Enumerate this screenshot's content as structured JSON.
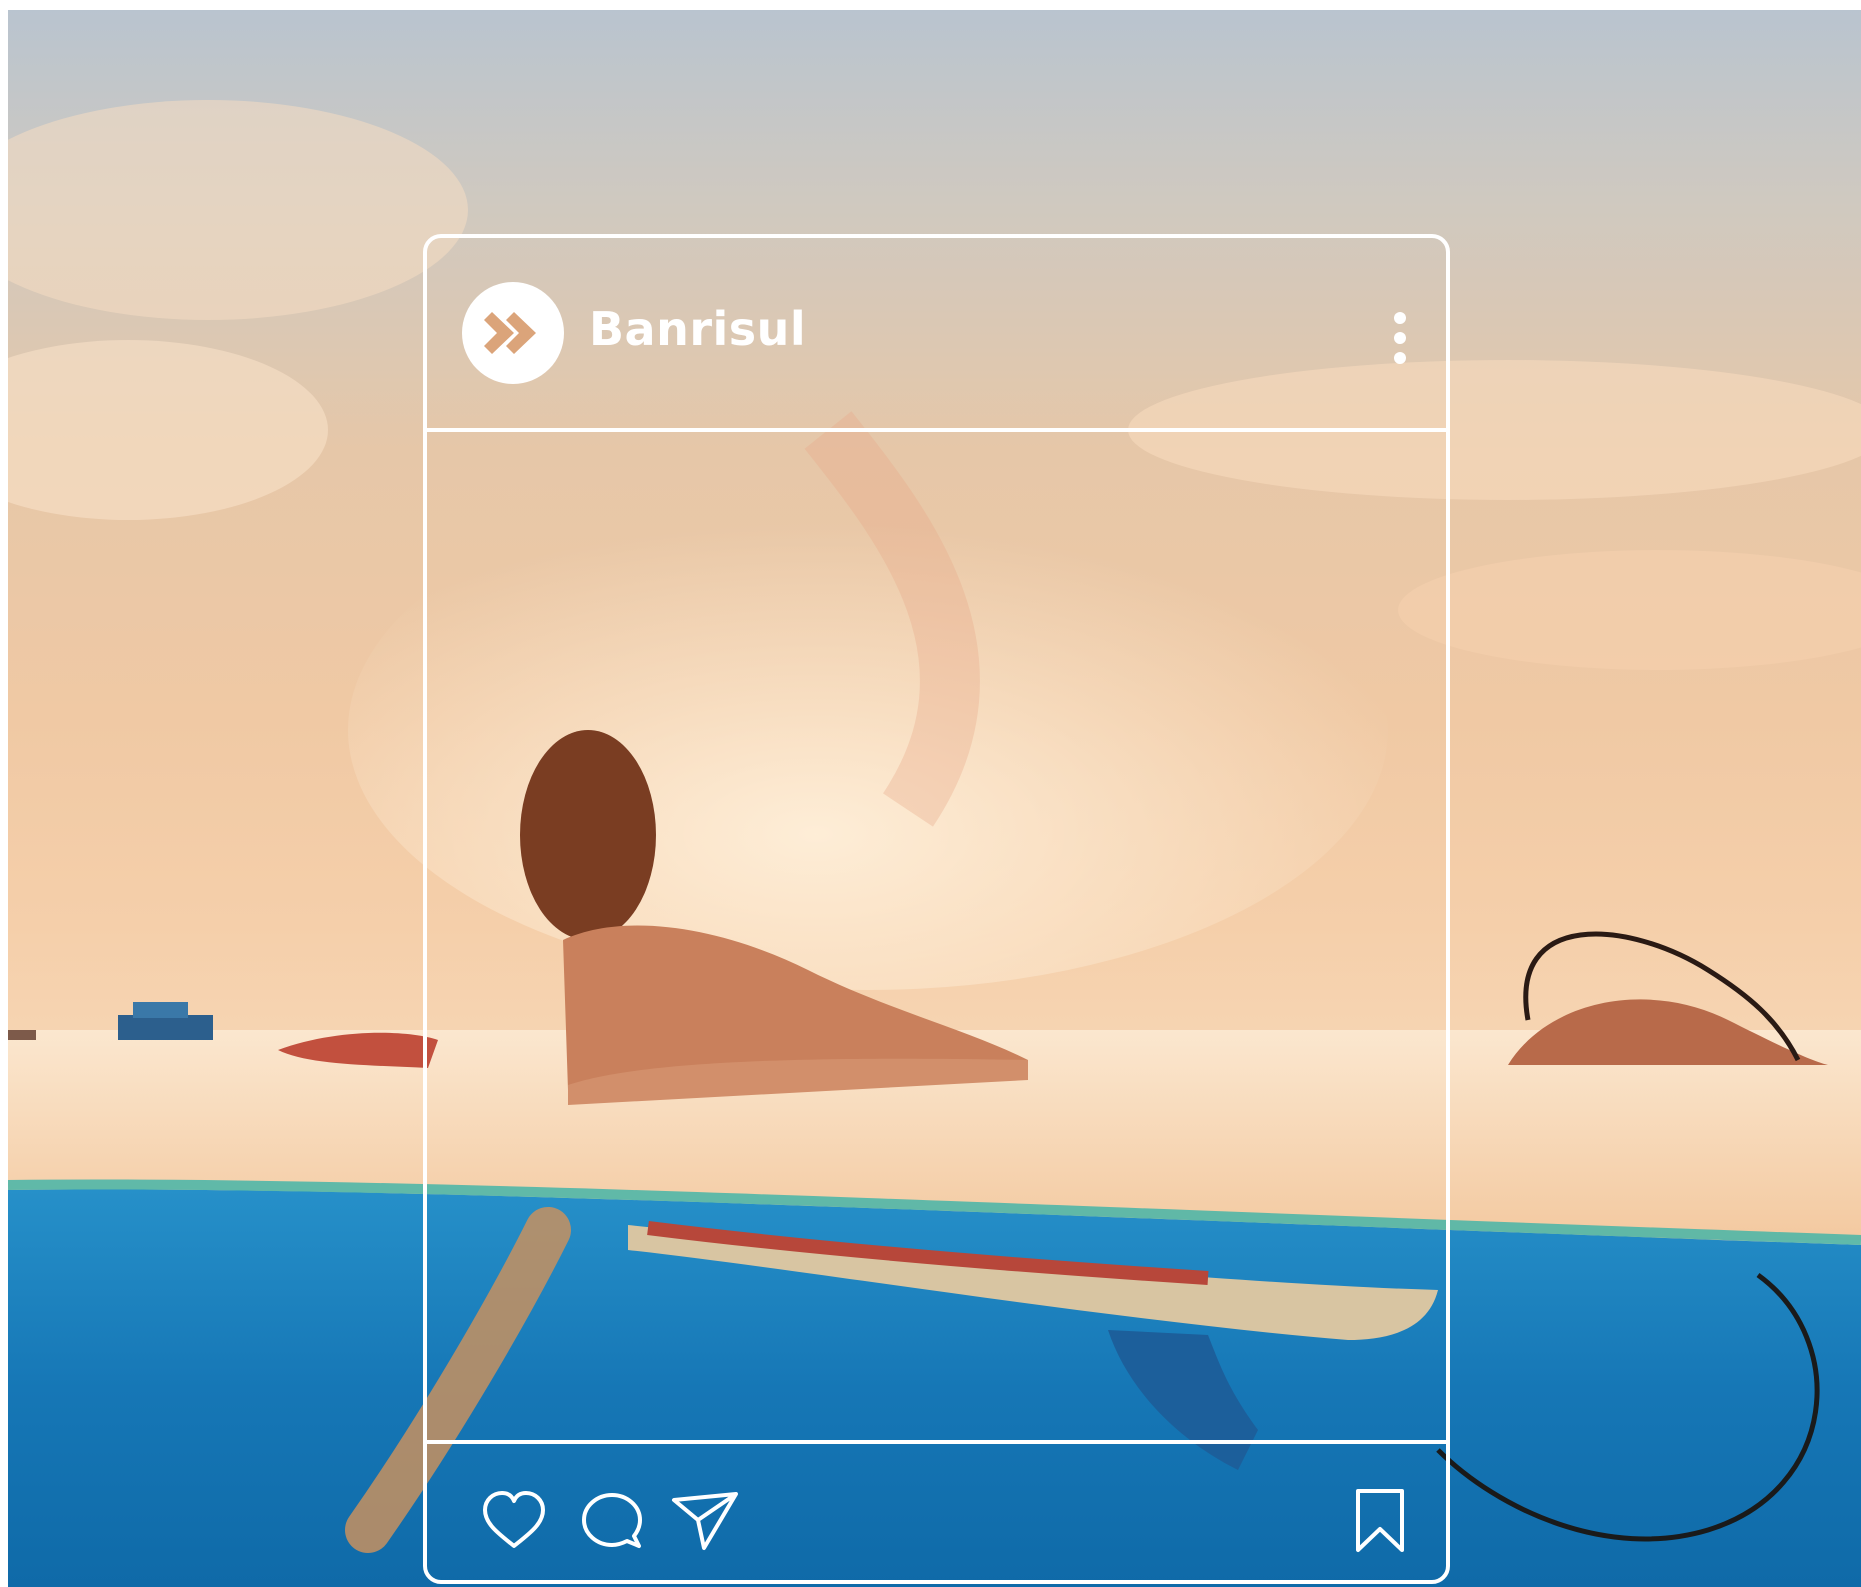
{
  "post": {
    "account_name": "Banrisul"
  },
  "icons": {
    "avatar": "banrisul-logo-icon",
    "more": "more-vertical-icon",
    "like": "heart-icon",
    "comment": "comment-icon",
    "share": "send-icon",
    "save": "bookmark-icon"
  },
  "colors": {
    "frame": "#ffffff",
    "sky": "#f0c9a4",
    "water": "#1f86c2"
  }
}
